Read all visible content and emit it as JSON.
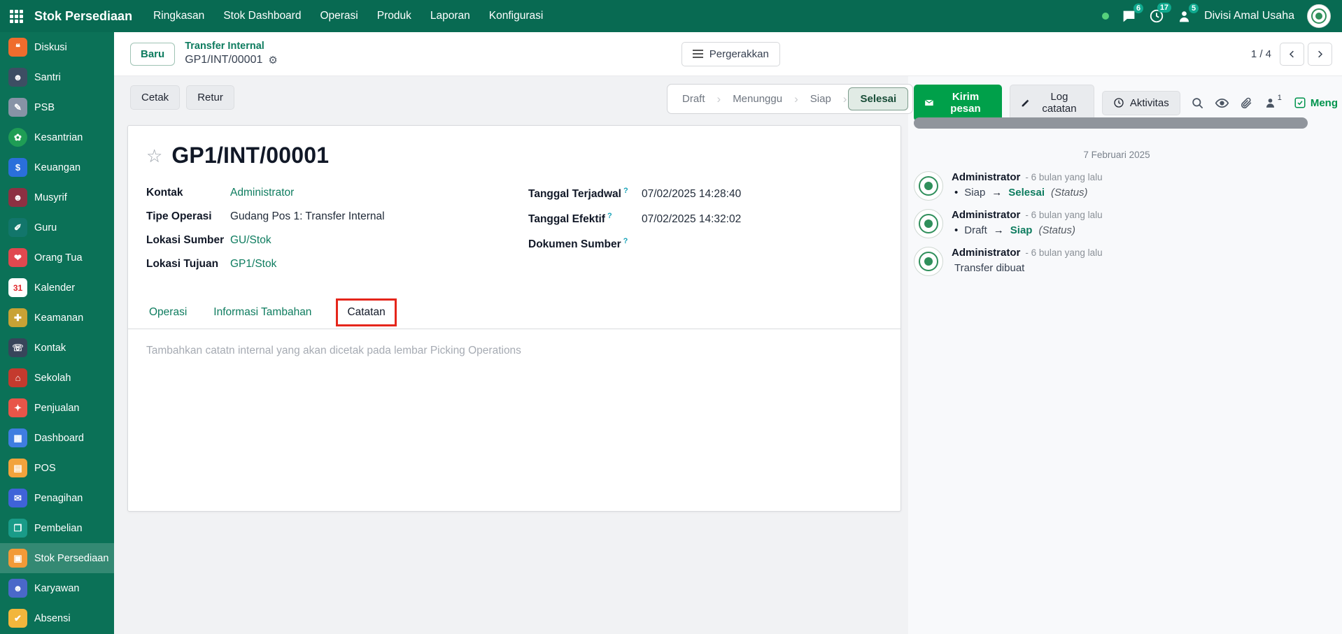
{
  "colors": {
    "topbar_bg": "#086a52",
    "sidebar_bg": "#0b7157",
    "accent_green": "#0e7c5f",
    "primary_green": "#00a04a",
    "annotation_red": "#e5261b",
    "badge_teal": "#0fa98e",
    "status_done_bg": "#e1ebe5",
    "status_done_text": "#194d38"
  },
  "icons": {
    "gear": "⚙",
    "star": "☆",
    "bullet": "•",
    "chevron_sep": "›"
  },
  "topbar": {
    "app_title": "Stok Persediaan",
    "menu": [
      {
        "label": "Ringkasan"
      },
      {
        "label": "Stok Dashboard"
      },
      {
        "label": "Operasi"
      },
      {
        "label": "Produk"
      },
      {
        "label": "Laporan"
      },
      {
        "label": "Konfigurasi"
      }
    ],
    "badges": {
      "messages": "6",
      "activities": "17",
      "requests": "5"
    },
    "company": "Divisi Amal Usaha"
  },
  "sidebar": {
    "items": [
      {
        "label": "Diskusi",
        "icon": "chat-icon",
        "glyph": "❝"
      },
      {
        "label": "Santri",
        "icon": "student-icon",
        "glyph": "☻"
      },
      {
        "label": "PSB",
        "icon": "registration-icon",
        "glyph": "✎"
      },
      {
        "label": "Kesantrian",
        "icon": "community-icon",
        "glyph": "✿"
      },
      {
        "label": "Keuangan",
        "icon": "finance-icon",
        "glyph": "$"
      },
      {
        "label": "Musyrif",
        "icon": "mentor-icon",
        "glyph": "☻"
      },
      {
        "label": "Guru",
        "icon": "teacher-icon",
        "glyph": "✐"
      },
      {
        "label": "Orang Tua",
        "icon": "parents-icon",
        "glyph": "❤"
      },
      {
        "label": "Kalender",
        "icon": "calendar-icon",
        "glyph": "31"
      },
      {
        "label": "Keamanan",
        "icon": "security-icon",
        "glyph": "✚"
      },
      {
        "label": "Kontak",
        "icon": "contacts-icon",
        "glyph": "☏"
      },
      {
        "label": "Sekolah",
        "icon": "school-icon",
        "glyph": "⌂"
      },
      {
        "label": "Penjualan",
        "icon": "sales-icon",
        "glyph": "✦"
      },
      {
        "label": "Dashboard",
        "icon": "dashboard-icon",
        "glyph": "▦"
      },
      {
        "label": "POS",
        "icon": "pos-icon",
        "glyph": "▤"
      },
      {
        "label": "Penagihan",
        "icon": "billing-icon",
        "glyph": "✉"
      },
      {
        "label": "Pembelian",
        "icon": "purchase-icon",
        "glyph": "❒"
      },
      {
        "label": "Stok Persediaan",
        "icon": "inventory-icon",
        "glyph": "▣",
        "active": true
      },
      {
        "label": "Karyawan",
        "icon": "employees-icon",
        "glyph": "☻"
      },
      {
        "label": "Absensi",
        "icon": "attendance-icon",
        "glyph": "✔"
      }
    ]
  },
  "breadcrumb": {
    "status_badge": "Baru",
    "parent": "Transfer Internal",
    "current": "GP1/INT/00001",
    "move_button": "Pergerakkan",
    "pager": "1 / 4"
  },
  "control": {
    "print_button": "Cetak",
    "return_button": "Retur",
    "statusbar": [
      {
        "label": "Draft"
      },
      {
        "label": "Menunggu"
      },
      {
        "label": "Siap"
      },
      {
        "label": "Selesai",
        "active": true
      }
    ]
  },
  "sheet": {
    "title": "GP1/INT/00001",
    "fields": {
      "contact": {
        "label": "Kontak",
        "value": "Administrator"
      },
      "operation_type": {
        "label": "Tipe Operasi",
        "value": "Gudang Pos 1: Transfer Internal"
      },
      "source_location": {
        "label": "Lokasi Sumber",
        "value": "GU/Stok"
      },
      "dest_location": {
        "label": "Lokasi Tujuan",
        "value": "GP1/Stok"
      },
      "scheduled_date": {
        "label": "Tanggal Terjadwal",
        "help": "?",
        "value": "07/02/2025 14:28:40"
      },
      "effective_date": {
        "label": "Tanggal Efektif",
        "help": "?",
        "value": "07/02/2025 14:32:02"
      },
      "source_document": {
        "label": "Dokumen Sumber",
        "help": "?",
        "value": ""
      }
    },
    "tabs": [
      {
        "label": "Operasi"
      },
      {
        "label": "Informasi Tambahan"
      },
      {
        "label": "Catatan",
        "active": true
      }
    ],
    "note_placeholder": "Tambahkan catatn internal yang akan dicetak pada lembar Picking Operations"
  },
  "chatter": {
    "send_button": "Kirim pesan",
    "log_button": "Log catatan",
    "activity_button": "Aktivitas",
    "follower_count": "1",
    "follow_button": "Meng",
    "date_separator": "7 Februari 2025",
    "messages": [
      {
        "author": "Administrator",
        "time": "- 6 bulan yang lalu",
        "from": "Siap",
        "arrow": "→",
        "to": "Selesai",
        "suffix": "(Status)"
      },
      {
        "author": "Administrator",
        "time": "- 6 bulan yang lalu",
        "from": "Draft",
        "arrow": "→",
        "to": "Siap",
        "suffix": "(Status)"
      },
      {
        "author": "Administrator",
        "time": "- 6 bulan yang lalu",
        "text": "Transfer dibuat"
      }
    ]
  }
}
